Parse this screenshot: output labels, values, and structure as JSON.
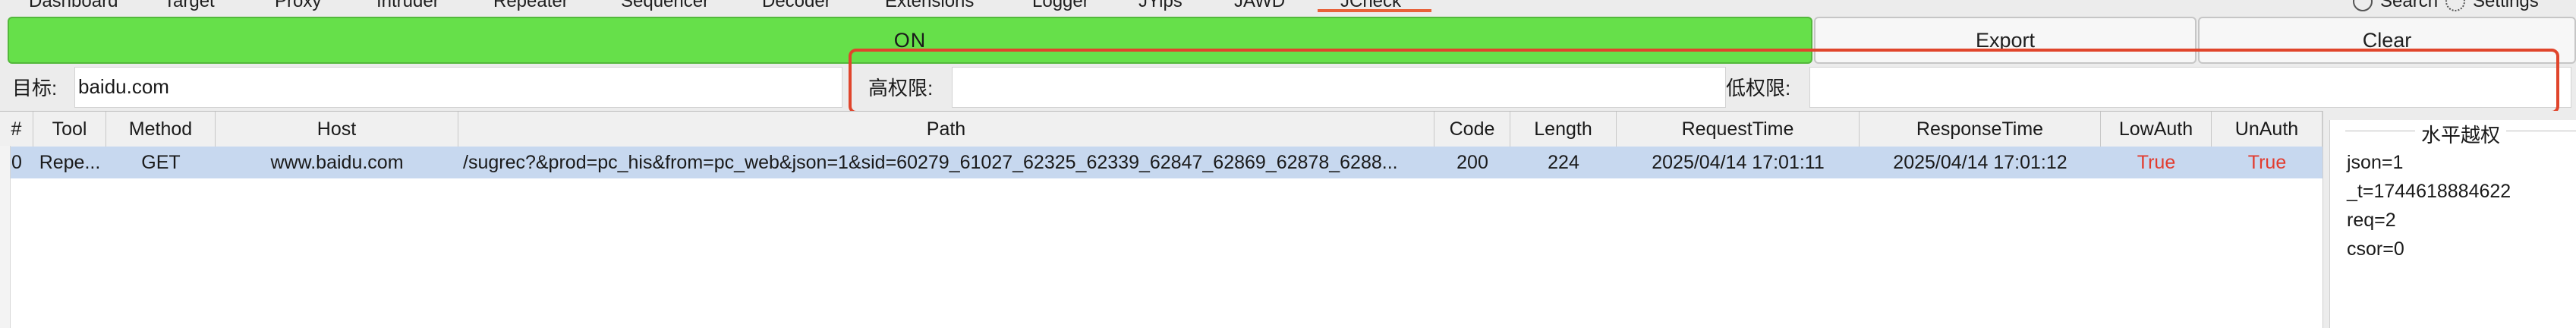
{
  "top_tabs": [
    "Dashboard",
    "Target",
    "Proxy",
    "Intruder",
    "Repeater",
    "Sequencer",
    "Decoder",
    "Extensions",
    "Logger",
    "JYips",
    "JAWD",
    "JCheck"
  ],
  "top_right": {
    "search_label": "Search",
    "settings_label": "Settings"
  },
  "buttons": {
    "on_label": "ON",
    "export_label": "Export",
    "clear_label": "Clear"
  },
  "colors": {
    "on_button": "#66e04a",
    "highlight_box": "#e0452c",
    "selected_row": "#c7d8ef",
    "auth_true": "#e23b2e"
  },
  "fields": {
    "target_label": "目标:",
    "target_value": "baidu.com",
    "high_priv_label": "高权限:",
    "high_priv_value": "",
    "low_priv_label": "低权限:",
    "low_priv_value": ""
  },
  "table": {
    "headers": [
      "#",
      "Tool",
      "Method",
      "Host",
      "Path",
      "Code",
      "Length",
      "RequestTime",
      "ResponseTime",
      "LowAuth",
      "UnAuth"
    ],
    "rows": [
      {
        "num": "0",
        "tool": "Repe...",
        "method": "GET",
        "host": "www.baidu.com",
        "path": "/sugrec?&prod=pc_his&from=pc_web&json=1&sid=60279_61027_62325_62339_62847_62869_62878_6288...",
        "code": "200",
        "length": "224",
        "request_time": "2025/04/14 17:01:11",
        "response_time": "2025/04/14 17:01:12",
        "low_auth": "True",
        "un_auth": "True"
      }
    ]
  },
  "right_panel": {
    "title": "水平越权",
    "params": [
      "json=1",
      "_t=1744618884622",
      "req=2",
      "csor=0"
    ]
  }
}
